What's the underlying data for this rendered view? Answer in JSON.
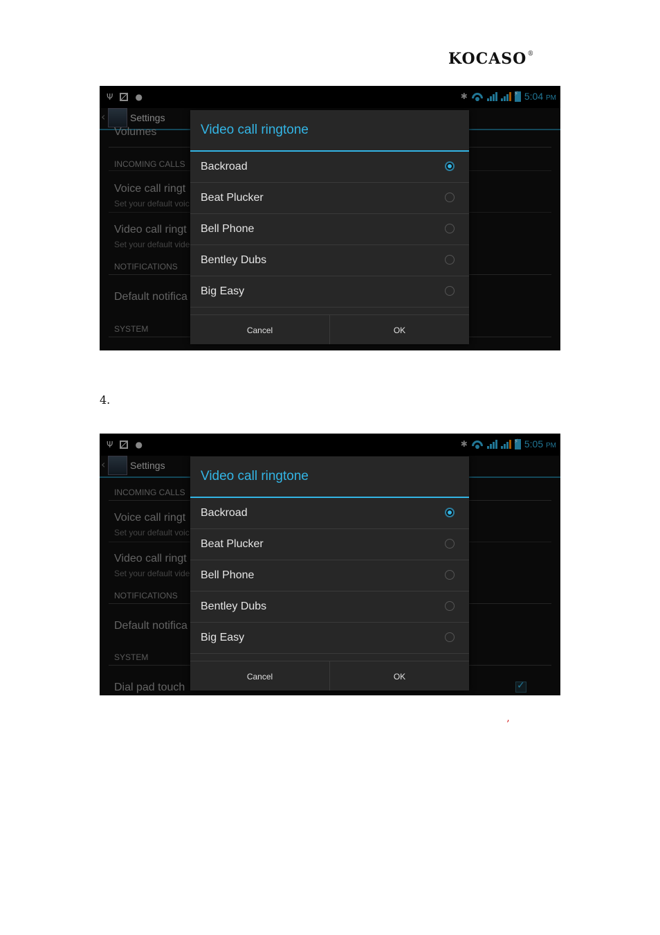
{
  "header": {
    "brand": "KOCASO",
    "registered": "®"
  },
  "step_label": "4.",
  "footnote_mark": "’",
  "screens": [
    {
      "status": {
        "time": "5:04",
        "ampm": "PM"
      },
      "actionbar": {
        "title": "Settings"
      },
      "background": {
        "partial_item": "Volumes",
        "incoming_calls_header": "INCOMING CALLS",
        "voice_title": "Voice call ringt",
        "voice_sub": "Set your default voic",
        "video_title": "Video call ringt",
        "video_sub": "Set your default vide",
        "notifications_header": "NOTIFICATIONS",
        "default_notif": "Default notifica",
        "system_header": "SYSTEM"
      },
      "dialog": {
        "title": "Video call ringtone",
        "options": [
          {
            "label": "Backroad",
            "selected": true
          },
          {
            "label": "Beat Plucker",
            "selected": false
          },
          {
            "label": "Bell Phone",
            "selected": false
          },
          {
            "label": "Bentley Dubs",
            "selected": false
          },
          {
            "label": "Big Easy",
            "selected": false
          }
        ],
        "cancel": "Cancel",
        "ok": "OK"
      }
    },
    {
      "status": {
        "time": "5:05",
        "ampm": "PM"
      },
      "actionbar": {
        "title": "Settings"
      },
      "background": {
        "incoming_calls_header": "INCOMING CALLS",
        "voice_title": "Voice call ringt",
        "voice_sub": "Set your default voic",
        "video_title": "Video call ringt",
        "video_sub": "Set your default vide",
        "notifications_header": "NOTIFICATIONS",
        "default_notif": "Default notifica",
        "system_header": "SYSTEM",
        "dial_pad": "Dial pad touch"
      },
      "dialog": {
        "title": "Video call ringtone",
        "options": [
          {
            "label": "Backroad",
            "selected": true
          },
          {
            "label": "Beat Plucker",
            "selected": false
          },
          {
            "label": "Bell Phone",
            "selected": false
          },
          {
            "label": "Bentley Dubs",
            "selected": false
          },
          {
            "label": "Big Easy",
            "selected": false
          }
        ],
        "cancel": "Cancel",
        "ok": "OK"
      }
    }
  ]
}
